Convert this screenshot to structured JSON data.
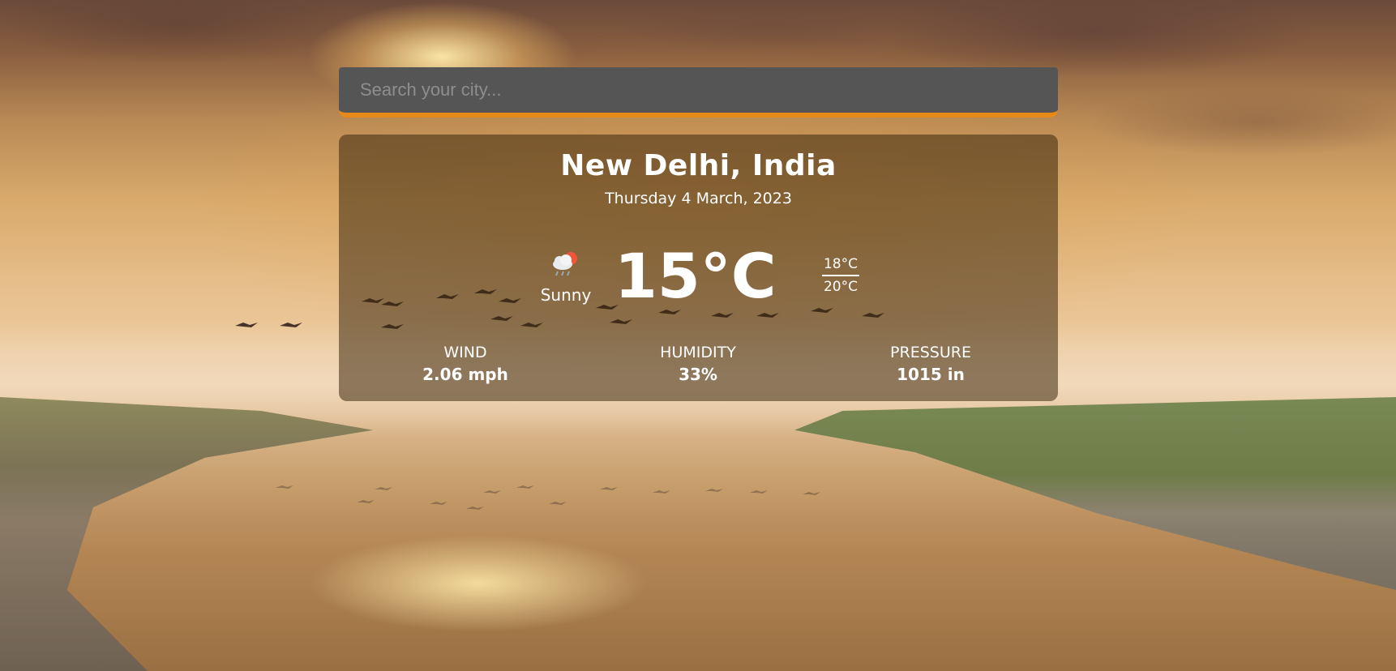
{
  "search": {
    "placeholder": "Search your city...",
    "value": ""
  },
  "weather": {
    "location": "New Delhi, India",
    "date": "Thursday 4 March, 2023",
    "condition": "Sunny",
    "condition_icon": "cloud-sun-rain-icon",
    "temperature": "15°C",
    "temp_high": "18°C",
    "temp_low": "20°C",
    "stats": {
      "wind": {
        "label": "WIND",
        "value": "2.06 mph"
      },
      "humidity": {
        "label": "HUMIDITY",
        "value": "33%"
      },
      "pressure": {
        "label": "PRESSURE",
        "value": "1015 in"
      }
    }
  },
  "colors": {
    "accent": "#e88a1a",
    "search_bg": "#555555",
    "card_bg": "rgba(60,40,15,0.55)"
  }
}
